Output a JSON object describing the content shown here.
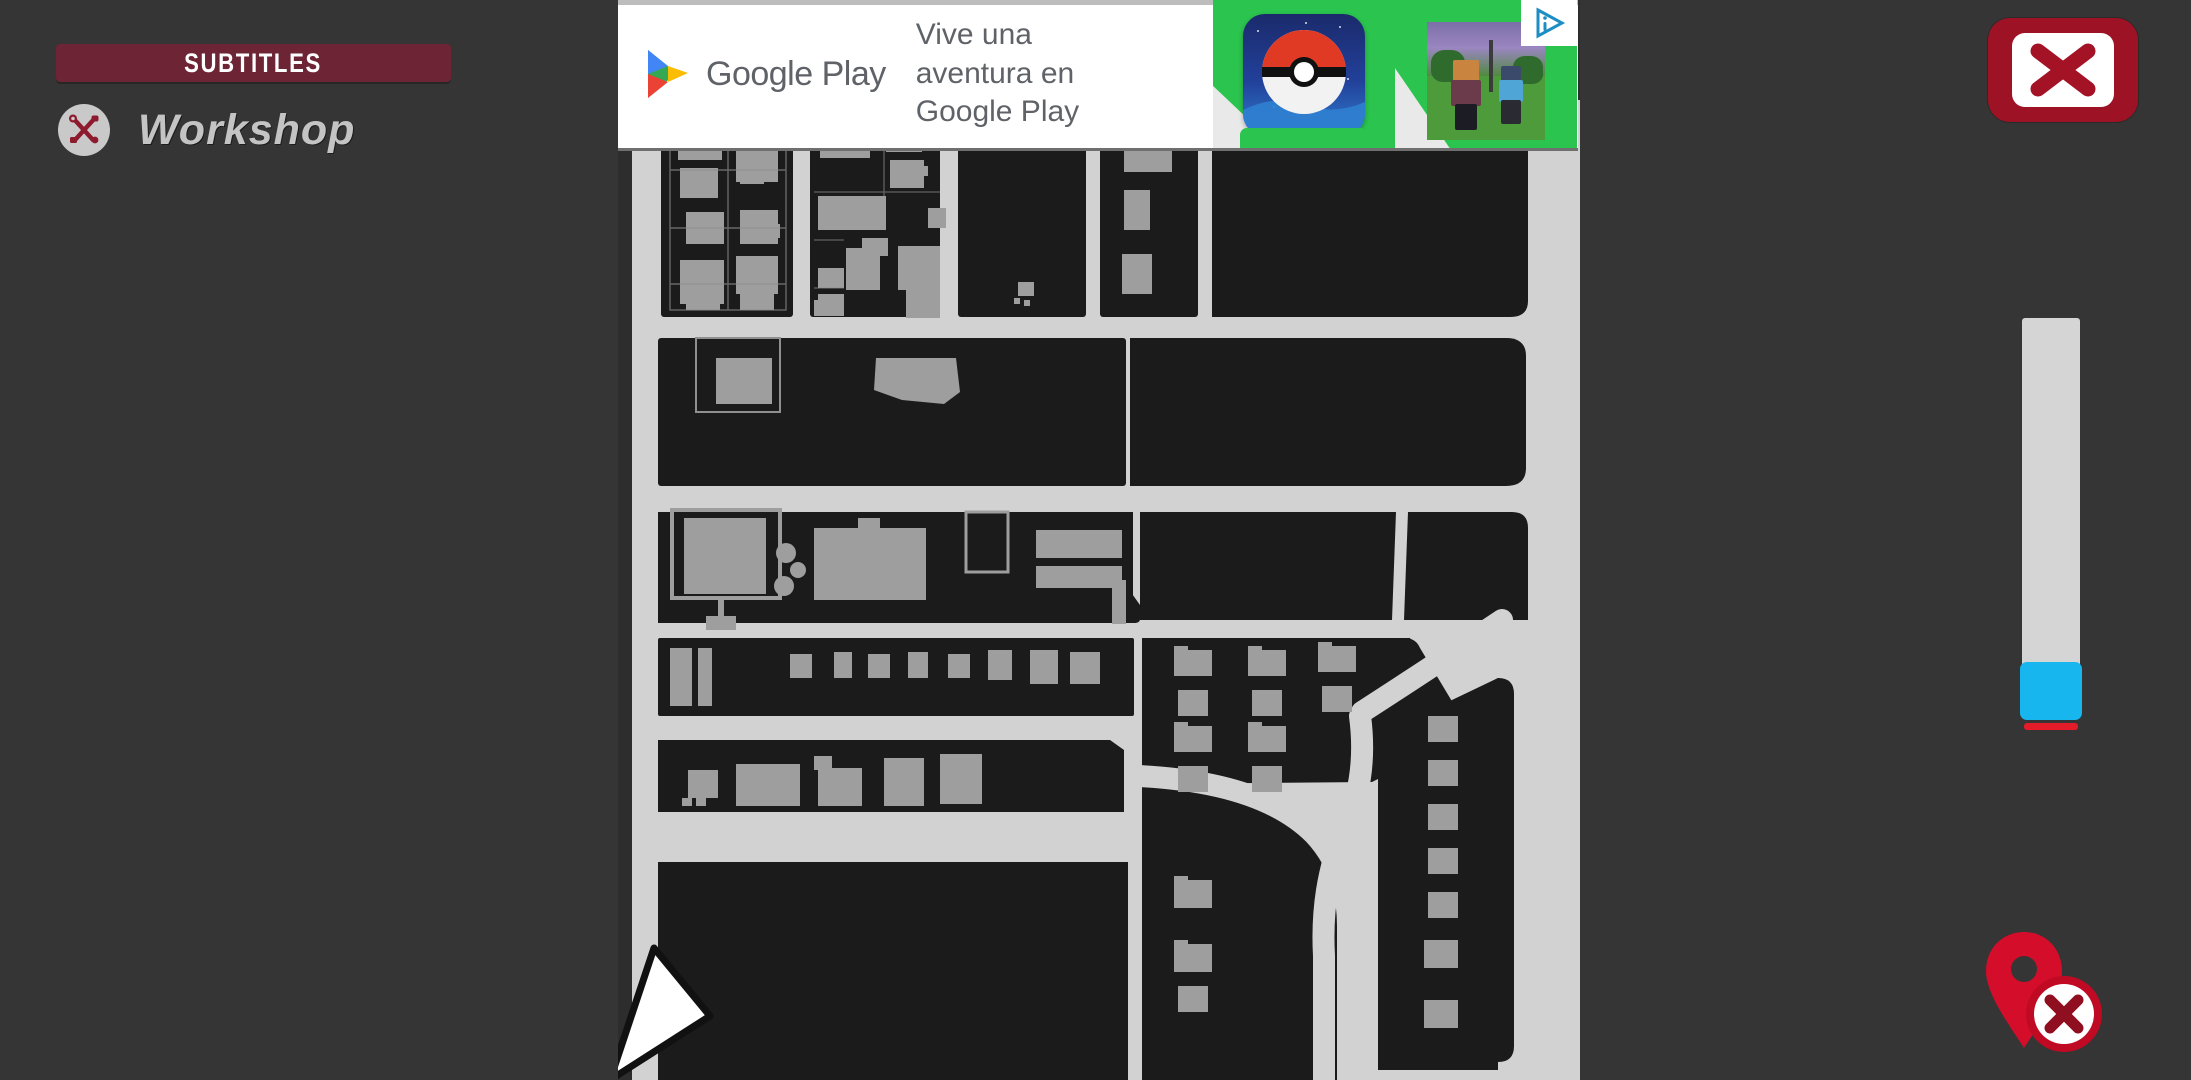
{
  "hud": {
    "subtitles_label": "SUBTITLES",
    "workshop_label": "Workshop",
    "workshop_icon": "tools-icon",
    "close_icon": "close-x-icon",
    "remove_marker_icon": "map-pin-remove-icon",
    "accent_red": "#6d2435",
    "close_red": "#9e1225",
    "slider_handle_color": "#18b6ee",
    "slider_base_color": "#e41b28",
    "background_color": "#353535"
  },
  "zoom_slider": {
    "name": "map-zoom-slider",
    "orientation": "vertical",
    "value_percent": 10
  },
  "ad": {
    "brand": "Google Play",
    "headline_line1": "Vive una",
    "headline_line2": "aventura en",
    "headline_line3": "Google Play",
    "play_icon": "google-play-triangle-icon",
    "card1_icon": "pokeball-app-icon",
    "card2_icon": "roblox-game-thumbnail",
    "adchoices_icon": "adchoices-icon",
    "background_color": "#ffffff",
    "green_color": "#2bc44e"
  },
  "map": {
    "road_color": "#d2d2d2",
    "block_color": "#1b1b1b",
    "building_color": "#9e9e9e",
    "surround_color": "#2d2d2d",
    "marker_icon": "workshop-tools-marker",
    "player_arrow_icon": "player-direction-arrow"
  }
}
